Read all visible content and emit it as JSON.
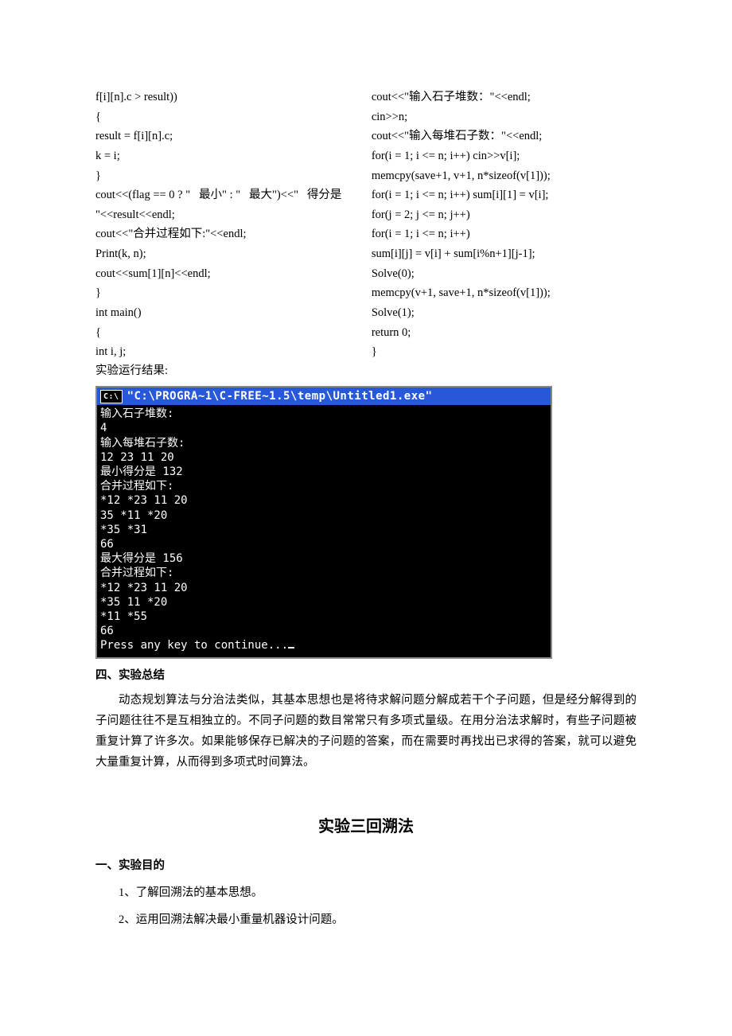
{
  "code_left": "f[i][n].c > result))\n{\nresult = f[i][n].c;\nk = i;\n}\ncout<<(flag == 0 ? \"   最小\" : \"   最大\")<<\"   得分是\n\"<<result<<endl;\ncout<<\"合并过程如下:\"<<endl;\nPrint(k, n);\ncout<<sum[1][n]<<endl;\n}\nint main()\n{\nint i, j;",
  "code_right": "cout<<\"输入石子堆数：\"<<endl;\ncin>>n;\ncout<<\"输入每堆石子数：\"<<endl;\nfor(i = 1; i <= n; i++) cin>>v[i];\nmemcpy(save+1, v+1, n*sizeof(v[1]));\nfor(i = 1; i <= n; i++) sum[i][1] = v[i];\nfor(j = 2; j <= n; j++)\nfor(i = 1; i <= n; i++)\nsum[i][j] = v[i] + sum[i%n+1][j-1];\nSolve(0);\nmemcpy(v+1, save+1, n*sizeof(v[1]));\nSolve(1);\nreturn 0;\n}",
  "result_label": "实验运行结果:",
  "terminal": {
    "title": "\"C:\\PROGRA~1\\C-FREE~1.5\\temp\\Untitled1.exe\"",
    "output": "输入石子堆数:\n4\n输入每堆石子数:\n12 23 11 20\n最小得分是 132\n合并过程如下:\n*12 *23 11 20\n35 *11 *20\n*35 *31\n66\n最大得分是 156\n合并过程如下:\n*12 *23 11 20\n*35 11 *20\n*11 *55\n66\nPress any key to continue..."
  },
  "summary": {
    "heading": "四、实验总结",
    "body": "动态规划算法与分治法类似，其基本思想也是将待求解问题分解成若干个子问题，但是经分解得到的子问题往往不是互相独立的。不同子问题的数目常常只有多项式量级。在用分治法求解时，有些子问题被重复计算了许多次。如果能够保存已解决的子问题的答案，而在需要时再找出已求得的答案，就可以避免大量重复计算，从而得到多项式时间算法。"
  },
  "chapter": "实验三回溯法",
  "purpose": {
    "heading": "一、实验目的",
    "items": [
      "1、了解回溯法的基本思想。",
      "2、运用回溯法解决最小重量机器设计问题。"
    ]
  }
}
